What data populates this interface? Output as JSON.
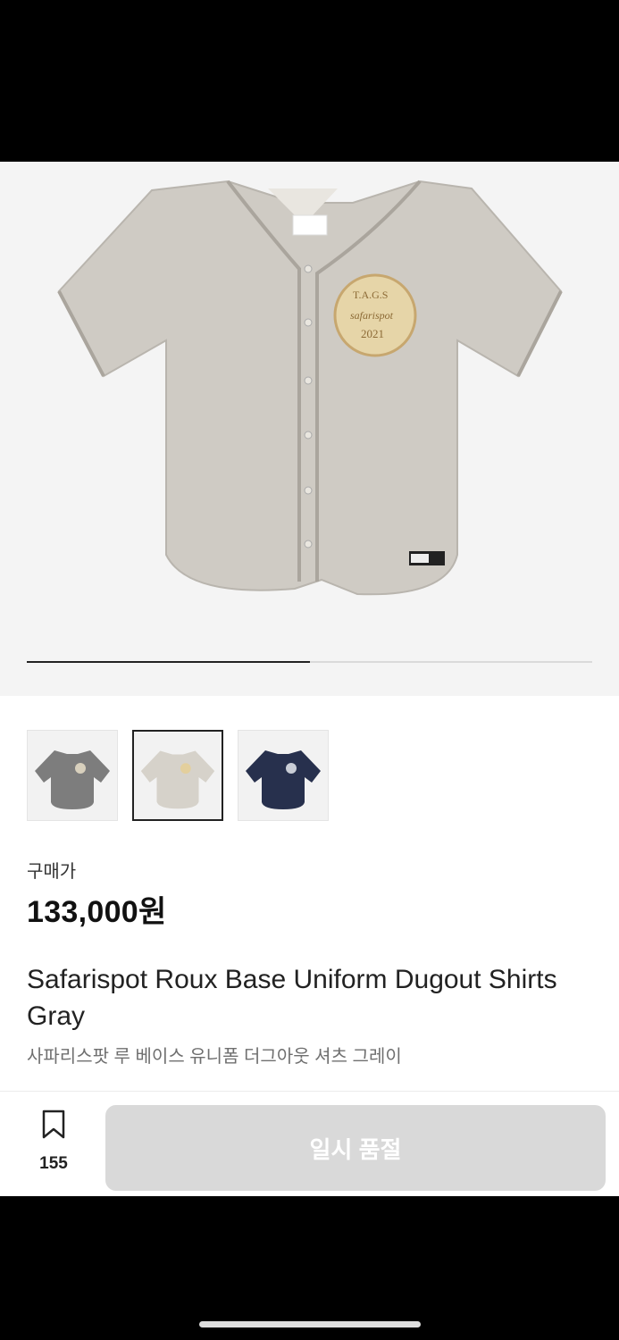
{
  "gallery": {
    "progress": 0.5,
    "patch": {
      "line1": "T.A.G.S",
      "line2": "safarispot",
      "line3": "2021"
    }
  },
  "color_options": [
    {
      "name": "charcoal",
      "color": "#7d7d7d",
      "selected": false
    },
    {
      "name": "gray",
      "color": "#d6d2ca",
      "selected": true
    },
    {
      "name": "navy",
      "color": "#27304d",
      "selected": false
    }
  ],
  "product": {
    "price_label": "구매가",
    "price": "133,000원",
    "title_en": "Safarispot Roux Base Uniform Dugout Shirts Gray",
    "title_ko": "사파리스팟 루 베이스 유니폼 더그아웃 셔츠 그레이"
  },
  "bottom_bar": {
    "wish_count": "155",
    "buy_button_label": "일시 품절"
  },
  "icons": [
    "bookmark-icon"
  ]
}
